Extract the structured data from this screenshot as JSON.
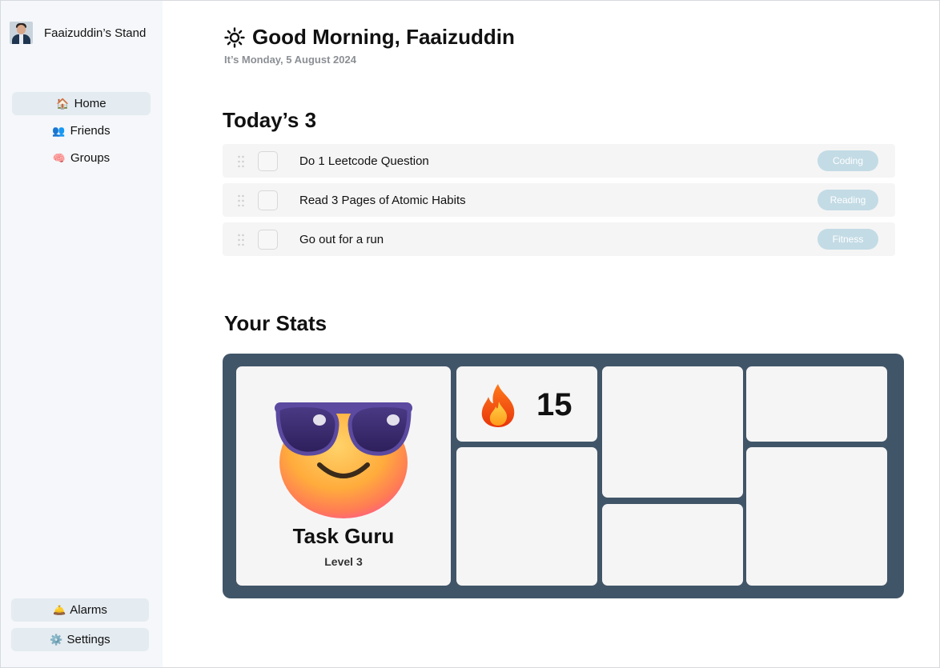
{
  "sidebar": {
    "profile_name": "Faaizuddin’s Stand",
    "nav": [
      {
        "icon": "🏠",
        "label": "Home"
      },
      {
        "icon": "👥",
        "label": "Friends"
      },
      {
        "icon": "🧠",
        "label": "Groups"
      }
    ],
    "alarms": {
      "icon": "🛎️",
      "label": "Alarms"
    },
    "settings": {
      "icon": "⚙️",
      "label": "Settings"
    }
  },
  "header": {
    "greeting": "Good Morning, Faaizuddin",
    "date": "It’s Monday, 5 August 2024"
  },
  "today": {
    "title": "Today’s 3",
    "tasks": [
      {
        "text": "Do 1 Leetcode Question",
        "tag": "Coding"
      },
      {
        "text": "Read 3 Pages of Atomic Habits",
        "tag": "Reading"
      },
      {
        "text": "Go out for a run",
        "tag": "Fitness"
      }
    ]
  },
  "stats": {
    "title": "Your Stats",
    "badge_title": "Task Guru",
    "badge_level": "Level 3",
    "streak_value": "15"
  },
  "colors": {
    "stats_bg": "#415568",
    "tag_bg": "#c3dbe5",
    "nav_active": "#e4ebf1"
  }
}
